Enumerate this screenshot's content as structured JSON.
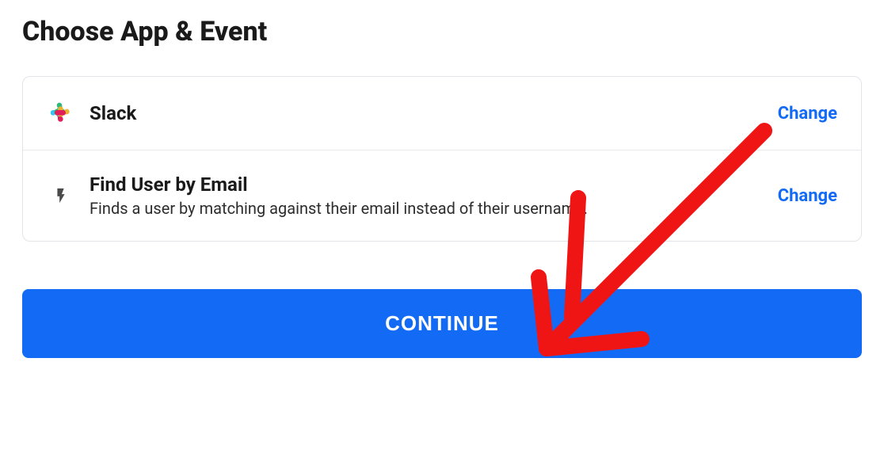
{
  "heading": "Choose App & Event",
  "appRow": {
    "title": "Slack",
    "change_label": "Change"
  },
  "eventRow": {
    "title": "Find User by Email",
    "description": "Finds a user by matching against their email instead of their username.",
    "change_label": "Change"
  },
  "continue_label": "CONTINUE",
  "colors": {
    "primary": "#136bf5",
    "annotation": "#f01515"
  }
}
